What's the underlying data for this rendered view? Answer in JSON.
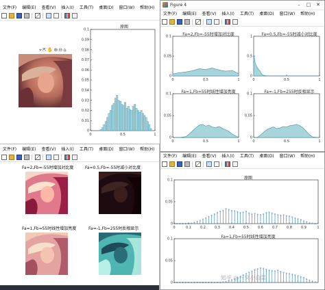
{
  "menu_items": [
    "文件(F)",
    "编辑(E)",
    "查看(V)",
    "插入(I)",
    "工具(T)",
    "桌面(D)",
    "窗口(W)",
    "帮助(H)"
  ],
  "menu_items_short": [
    "文件(F)",
    "编辑(E)",
    "查看(V)",
    "插入(I)",
    "工具(T)",
    "桌面(D)",
    "窗口(W)",
    "帮助(H)"
  ],
  "window_topleft": {
    "axes_title": "原图",
    "x_ticks": [
      "0",
      "0.5",
      "1"
    ],
    "y_ticks": [
      "0",
      "0.01",
      "0.02",
      "0.03",
      "0.04",
      "0.05",
      "0.06",
      "0.07",
      "0.08",
      "0.09",
      "0.1"
    ]
  },
  "window_fig4": {
    "title": "Figure 4",
    "subplots": [
      {
        "title": "Fa=2,Fb=-55时增加对比度",
        "y_ticks": [
          "0",
          "0.05",
          "0.1"
        ],
        "x_ticks": [
          "0",
          "0.5",
          "1"
        ]
      },
      {
        "title": "Fa=0.5,Fb=-55时减小对比度",
        "y_ticks": [
          "0",
          "0.5",
          "1"
        ],
        "x_ticks": [
          "0",
          "0.5",
          "1"
        ]
      },
      {
        "title": "Fa=1,Fb=55时线性增加亮度",
        "y_ticks": [
          "0",
          "0.05",
          "0.1"
        ],
        "x_ticks": [
          "0",
          "0.5",
          "1"
        ]
      },
      {
        "title": "Fa=-1,Fb=255时反相显示",
        "y_ticks": [
          "0",
          "0.05",
          "0.1"
        ],
        "x_ticks": [
          "0",
          "0.5",
          "1"
        ]
      }
    ]
  },
  "window_bottomleft": {
    "image_titles": [
      "Fa=2,Fb=-55时增加对比度",
      "Fa=0.5,Fb=-55时减小对比度",
      "Fa=1,Fb=55时线性增加亮度",
      "Fa=-1,Fb=255时反相显示"
    ]
  },
  "window_bottomright": {
    "top_title": "原图",
    "top_y_ticks": [
      "0",
      "0.05",
      "0.1"
    ],
    "x_ticks": [
      "0",
      "0.1",
      "0.2",
      "0.3",
      "0.4",
      "0.5",
      "0.6",
      "0.7",
      "0.8",
      "0.9",
      "1"
    ],
    "bottom_title": "Fa=1,Fb=55时线性增加亮度",
    "bottom_y_ticks": [
      "0",
      "0.05",
      "0.1"
    ]
  },
  "watermark": "知乎 @一只小白菜",
  "colors": {
    "bar_fill": "#a9d4dc",
    "bar_edge": "#3b8fa6",
    "stem": "#2d7fa8",
    "axes": "#222222"
  },
  "chart_data": [
    {
      "type": "bar",
      "title": "原图",
      "xlim": [
        0,
        1
      ],
      "ylim": [
        0,
        0.1
      ],
      "x": [
        0.0,
        0.025,
        0.05,
        0.075,
        0.1,
        0.125,
        0.15,
        0.175,
        0.2,
        0.225,
        0.25,
        0.275,
        0.3,
        0.325,
        0.35,
        0.375,
        0.4,
        0.425,
        0.45,
        0.475,
        0.5,
        0.525,
        0.55,
        0.575,
        0.6,
        0.625,
        0.65,
        0.675,
        0.7,
        0.725,
        0.75,
        0.775,
        0.8,
        0.825,
        0.85,
        0.875,
        0.9,
        0.925,
        0.95,
        0.975
      ],
      "values": [
        0.0,
        0.0,
        0.0,
        0.0,
        0.0,
        0.0,
        0.001,
        0.003,
        0.006,
        0.009,
        0.013,
        0.017,
        0.02,
        0.025,
        0.027,
        0.032,
        0.035,
        0.03,
        0.029,
        0.026,
        0.025,
        0.028,
        0.022,
        0.024,
        0.021,
        0.02,
        0.024,
        0.026,
        0.022,
        0.02,
        0.018,
        0.02,
        0.017,
        0.015,
        0.013,
        0.009,
        0.006,
        0.002,
        0.0,
        0.0
      ]
    },
    {
      "type": "area",
      "title": "Fa=2,Fb=-55时增加对比度",
      "xlim": [
        0,
        1
      ],
      "ylim": [
        0,
        0.1
      ],
      "x": [
        0.0,
        0.1,
        0.2,
        0.3,
        0.4,
        0.5,
        0.6,
        0.7,
        0.8,
        0.9,
        1.0
      ],
      "values": [
        0.005,
        0.008,
        0.01,
        0.013,
        0.018,
        0.016,
        0.02,
        0.015,
        0.012,
        0.014,
        0.006
      ]
    },
    {
      "type": "area",
      "title": "Fa=0.5,Fb=-55时减小对比度",
      "xlim": [
        0,
        1
      ],
      "ylim": [
        0,
        1
      ],
      "x": [
        0.0,
        0.02,
        0.04,
        0.06,
        0.08,
        0.1,
        0.12,
        0.14,
        0.2,
        0.4,
        0.6,
        0.8,
        1.0
      ],
      "values": [
        0.55,
        0.35,
        0.25,
        0.2,
        0.15,
        0.12,
        0.05,
        0.02,
        0.0,
        0.0,
        0.0,
        0.0,
        0.0
      ]
    },
    {
      "type": "area",
      "title": "Fa=1,Fb=55时线性增加亮度",
      "xlim": [
        0,
        1
      ],
      "ylim": [
        0,
        0.1
      ],
      "x": [
        0.0,
        0.1,
        0.2,
        0.25,
        0.3,
        0.35,
        0.4,
        0.45,
        0.5,
        0.55,
        0.6,
        0.65,
        0.7,
        0.75,
        0.8,
        0.85,
        0.9,
        1.0
      ],
      "values": [
        0.0,
        0.0,
        0.002,
        0.008,
        0.015,
        0.022,
        0.028,
        0.03,
        0.026,
        0.028,
        0.024,
        0.022,
        0.025,
        0.021,
        0.018,
        0.014,
        0.008,
        0.0
      ]
    },
    {
      "type": "area",
      "title": "Fa=-1,Fb=255时反相显示",
      "xlim": [
        0,
        1
      ],
      "ylim": [
        0,
        0.1
      ],
      "x": [
        0.0,
        0.05,
        0.1,
        0.15,
        0.2,
        0.25,
        0.3,
        0.35,
        0.4,
        0.45,
        0.5,
        0.55,
        0.6,
        0.65,
        0.7,
        0.75,
        0.8,
        0.85,
        0.9,
        1.0
      ],
      "values": [
        0.0,
        0.0,
        0.005,
        0.012,
        0.018,
        0.021,
        0.024,
        0.02,
        0.022,
        0.025,
        0.024,
        0.027,
        0.028,
        0.03,
        0.027,
        0.022,
        0.014,
        0.006,
        0.001,
        0.0
      ]
    },
    {
      "type": "bar",
      "title": "原图",
      "xlim": [
        0,
        1
      ],
      "ylim": [
        0,
        0.1
      ],
      "x": [
        0.0,
        0.02,
        0.04,
        0.06,
        0.08,
        0.1,
        0.12,
        0.14,
        0.16,
        0.18,
        0.2,
        0.22,
        0.24,
        0.26,
        0.28,
        0.3,
        0.32,
        0.34,
        0.36,
        0.38,
        0.4,
        0.42,
        0.44,
        0.46,
        0.48,
        0.5,
        0.52,
        0.54,
        0.56,
        0.58,
        0.6,
        0.62,
        0.64,
        0.66,
        0.68,
        0.7,
        0.72,
        0.74,
        0.76,
        0.78,
        0.8,
        0.82,
        0.84,
        0.86,
        0.88,
        0.9,
        0.92,
        0.94,
        0.96,
        0.98
      ],
      "values": [
        0.0,
        0.0,
        0.0,
        0.0,
        0.0,
        0.0,
        0.001,
        0.003,
        0.005,
        0.007,
        0.01,
        0.013,
        0.016,
        0.019,
        0.022,
        0.025,
        0.028,
        0.03,
        0.034,
        0.032,
        0.03,
        0.029,
        0.027,
        0.025,
        0.026,
        0.028,
        0.024,
        0.022,
        0.023,
        0.021,
        0.02,
        0.022,
        0.025,
        0.026,
        0.024,
        0.022,
        0.02,
        0.019,
        0.02,
        0.018,
        0.017,
        0.015,
        0.013,
        0.011,
        0.009,
        0.006,
        0.004,
        0.002,
        0.001,
        0.0
      ]
    },
    {
      "type": "bar",
      "title": "Fa=1,Fb=55时线性增加亮度",
      "xlim": [
        0,
        1
      ],
      "ylim": [
        0,
        0.1
      ],
      "x": [
        0.0,
        0.02,
        0.04,
        0.06,
        0.08,
        0.1,
        0.12,
        0.14,
        0.16,
        0.18,
        0.2,
        0.22,
        0.24,
        0.26,
        0.28,
        0.3,
        0.32,
        0.34,
        0.36,
        0.38,
        0.4,
        0.42,
        0.44,
        0.46,
        0.48,
        0.5,
        0.52,
        0.54,
        0.56,
        0.58,
        0.6,
        0.62,
        0.64,
        0.66,
        0.68,
        0.7,
        0.72,
        0.74,
        0.76,
        0.78,
        0.8,
        0.82,
        0.84,
        0.86,
        0.88,
        0.9,
        0.92,
        0.94,
        0.96,
        0.98
      ],
      "values": [
        0.0,
        0.0,
        0.0,
        0.0,
        0.0,
        0.0,
        0.0,
        0.0,
        0.0,
        0.0,
        0.0,
        0.0,
        0.0,
        0.0,
        0.0,
        0.0,
        0.0,
        0.001,
        0.002,
        0.004,
        0.006,
        0.008,
        0.011,
        0.014,
        0.017,
        0.02,
        0.023,
        0.026,
        0.029,
        0.031,
        0.033,
        0.032,
        0.03,
        0.028,
        0.027,
        0.026,
        0.028,
        0.025,
        0.023,
        0.021,
        0.02,
        0.019,
        0.017,
        0.015,
        0.013,
        0.011,
        0.008,
        0.005,
        0.003,
        0.001
      ]
    }
  ]
}
